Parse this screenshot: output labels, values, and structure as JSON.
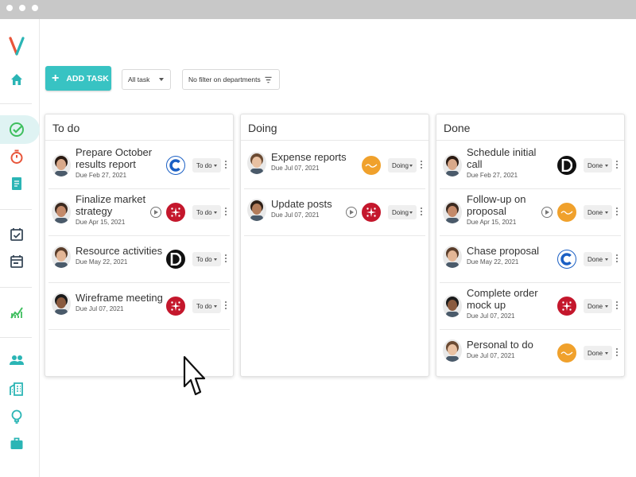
{
  "colors": {
    "accent": "#38c3c3",
    "sidebar_icon": "#2bb5b5",
    "red_icon": "#e8553a",
    "green_icon": "#3fbf5f"
  },
  "sidebar": {
    "items": [
      {
        "icon": "home-icon"
      },
      {
        "icon": "check-circle-icon",
        "active": true
      },
      {
        "icon": "timer-icon"
      },
      {
        "icon": "document-icon"
      },
      {
        "icon": "calendar-check-icon"
      },
      {
        "icon": "calendar-icon"
      },
      {
        "icon": "chart-icon"
      },
      {
        "icon": "people-icon"
      },
      {
        "icon": "building-icon"
      },
      {
        "icon": "lightbulb-icon"
      },
      {
        "icon": "briefcase-icon"
      }
    ]
  },
  "toolbar": {
    "add_task_label": "ADD TASK",
    "task_filter_value": "All task",
    "department_filter_value": "No filter on departments"
  },
  "columns": [
    {
      "title": "To do",
      "cards": [
        {
          "title": "Prepare October results report",
          "due": "Due Feb 27, 2021",
          "status": "To do",
          "company": "c-logo"
        },
        {
          "title": "Finalize market strategy",
          "due": "Due Apr 15, 2021",
          "status": "To do",
          "company": "stars-logo"
        },
        {
          "title": "Resource activities",
          "due": "Due May 22, 2021",
          "status": "To do",
          "company": "d-logo"
        },
        {
          "title": "Wireframe meeting",
          "due": "Due Jul 07, 2021",
          "status": "To do",
          "company": "stars-logo"
        }
      ]
    },
    {
      "title": "Doing",
      "cards": [
        {
          "title": "Expense reports",
          "due": "Due Jul 07, 2021",
          "status": "Doing",
          "company": "wave-logo"
        },
        {
          "title": "Update posts",
          "due": "Due Jul 07, 2021",
          "status": "Doing",
          "company": "stars-logo"
        }
      ]
    },
    {
      "title": "Done",
      "cards": [
        {
          "title": "Schedule initial call",
          "due": "Due Feb 27, 2021",
          "status": "Done",
          "company": "d-logo"
        },
        {
          "title": "Follow-up on proposal",
          "due": "Due Apr 15, 2021",
          "status": "Done",
          "company": "wave-logo"
        },
        {
          "title": "Chase proposal",
          "due": "Due May 22, 2021",
          "status": "Done",
          "company": "c-logo"
        },
        {
          "title": "Complete order mock up",
          "due": "Due Jul 07, 2021",
          "status": "Done",
          "company": "stars-logo"
        },
        {
          "title": "Personal to do",
          "due": "Due Jul 07, 2021",
          "status": "Done",
          "company": "wave-logo"
        }
      ]
    }
  ]
}
